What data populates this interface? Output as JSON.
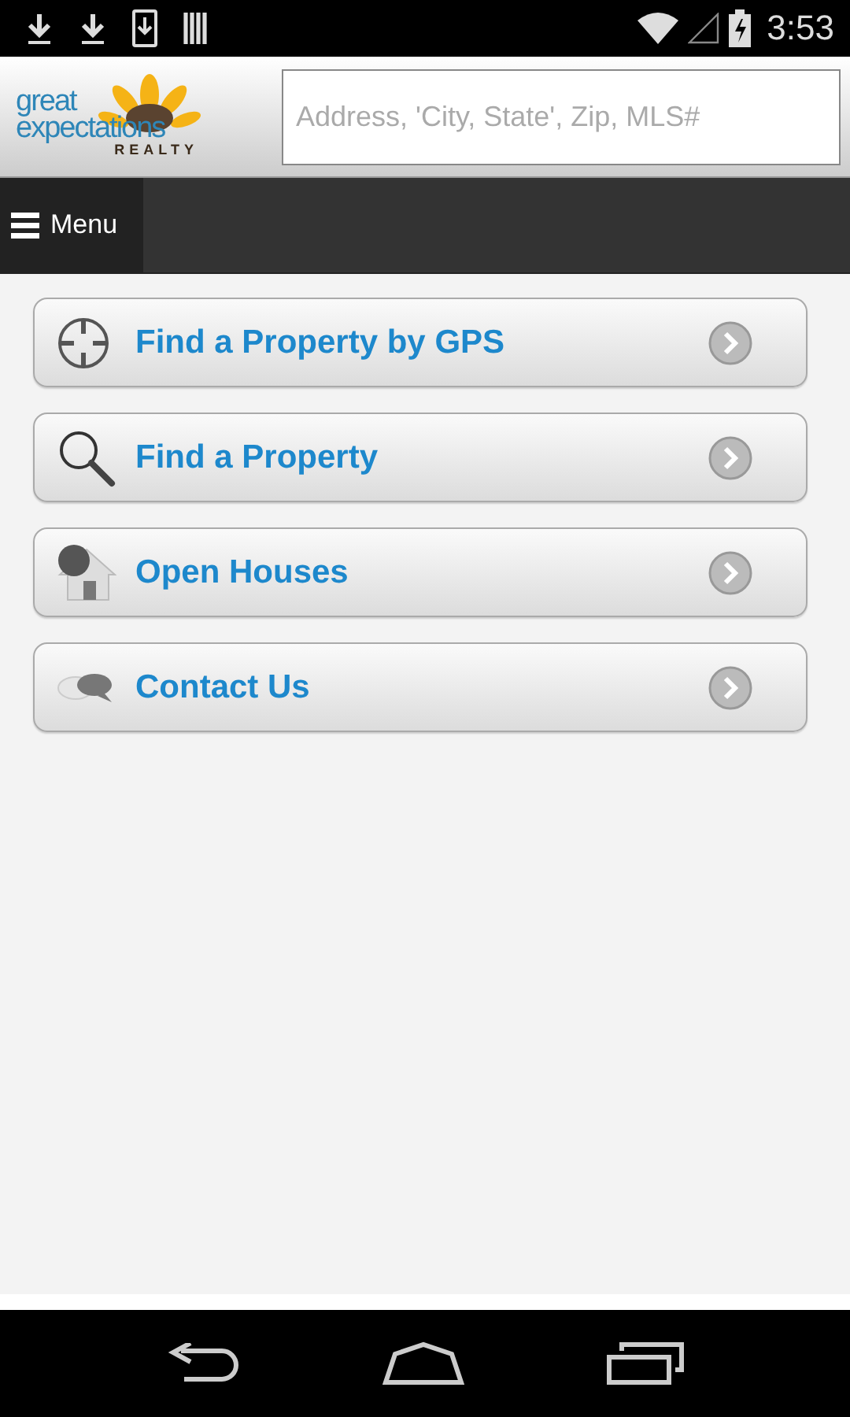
{
  "status_bar": {
    "time": "3:53"
  },
  "header": {
    "logo": {
      "line1": "great",
      "line2": "expectations",
      "line3": "REALTY"
    },
    "search": {
      "placeholder": "Address, 'City, State', Zip, MLS#"
    }
  },
  "menu_bar": {
    "label": "Menu"
  },
  "items": [
    {
      "kind": "gps",
      "label": "Find a Property by GPS"
    },
    {
      "kind": "search",
      "label": "Find a Property"
    },
    {
      "kind": "open-house",
      "label": "Open Houses"
    },
    {
      "kind": "chat",
      "label": "Contact Us"
    }
  ]
}
